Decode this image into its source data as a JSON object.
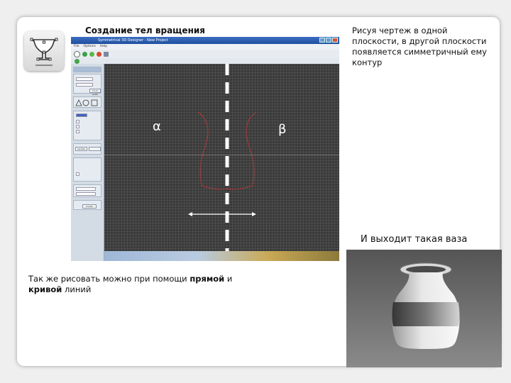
{
  "slide": {
    "title": "Создание тел вращения",
    "note_right": "Рисуя чертеж в одной плоскости, в другой плоскости появляется симметричный ему контур",
    "note_bottom_1": "Так же рисовать можно при помощи ",
    "note_bottom_bold1": "прямой",
    "note_bottom_2": " и ",
    "note_bottom_bold2": "кривой",
    "note_bottom_3": " линий",
    "vase_caption": "И выходит такая ваза"
  },
  "app_window": {
    "title": "Symmetrical 3D Designer - New Project",
    "menu": [
      "File",
      "Options",
      "Help"
    ],
    "panel_buttons": [
      "Front width",
      "Update",
      "Create"
    ],
    "colors": {
      "titlebar": "#2a5cb0",
      "canvas": "#3a3a3a",
      "contour": "#b83a3a",
      "axis": "#ffffff"
    }
  },
  "labels": {
    "alpha": "α",
    "beta": "β"
  }
}
